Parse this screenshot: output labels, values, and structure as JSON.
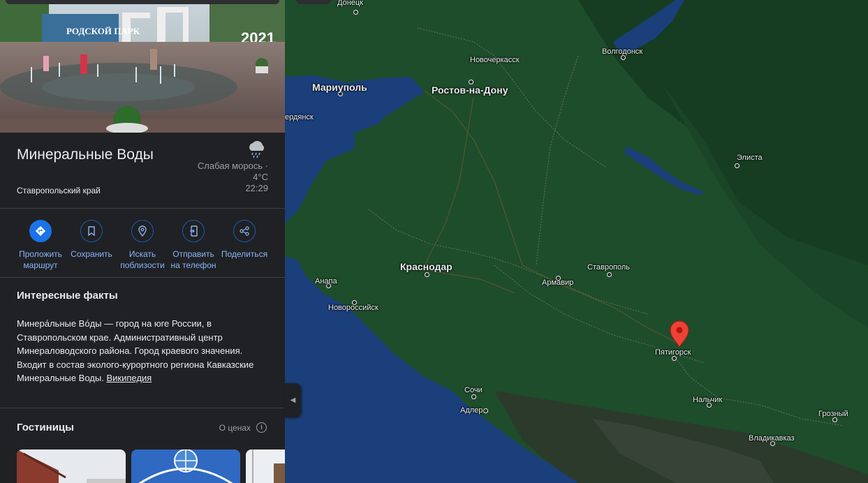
{
  "place": {
    "name": "Минеральные Воды",
    "region": "Ставропольский край",
    "weather": {
      "condition": "Слабая морось ·",
      "temperature": "4°C",
      "time": "22:29",
      "icon": "drizzle-icon"
    }
  },
  "actions": [
    {
      "label": "Проложить\nмаршрут",
      "icon": "directions-icon"
    },
    {
      "label": "Сохранить",
      "icon": "bookmark-icon"
    },
    {
      "label": "Искать\nпоблизости",
      "icon": "nearby-icon"
    },
    {
      "label": "Отправить\nна телефон",
      "icon": "send-to-phone-icon"
    },
    {
      "label": "Поделиться",
      "icon": "share-icon"
    }
  ],
  "facts": {
    "title": "Интересные факты",
    "text": "Минера́льные Во́ды — город на юге России, в Ставропольском крае. Административный центр Минераловодского района. Город краевого значения. Входит в состав эколого-курортного региона Кавказские Минеральные Воды.",
    "link": "Википедия"
  },
  "hotels": {
    "title": "Гостиницы",
    "prices_label": "О ценах"
  },
  "map": {
    "cities": [
      {
        "name": "Донецк",
        "big": false
      },
      {
        "name": "Новочеркасск",
        "big": false
      },
      {
        "name": "Волгодонск",
        "big": false
      },
      {
        "name": "Мариуполь",
        "big": true
      },
      {
        "name": "Ростов-на-Дону",
        "big": true
      },
      {
        "name": "ердянск",
        "big": false
      },
      {
        "name": "Элиста",
        "big": false
      },
      {
        "name": "Краснодар",
        "big": true
      },
      {
        "name": "Ставрополь",
        "big": false
      },
      {
        "name": "Анапа",
        "big": false
      },
      {
        "name": "Армавир",
        "big": false
      },
      {
        "name": "Новороссийск",
        "big": false
      },
      {
        "name": "Пятигорск",
        "big": false
      },
      {
        "name": "Сочи",
        "big": false
      },
      {
        "name": "Адлер",
        "big": false
      },
      {
        "name": "Нальчик",
        "big": false
      },
      {
        "name": "Грозный",
        "big": false
      },
      {
        "name": "Владикавказ",
        "big": false
      }
    ],
    "colors": {
      "sea": "#1a3f7a",
      "land": "#1e4d2b",
      "land_dark": "#163d21",
      "mountain": "#2c3a2c",
      "pin": "#ea4335"
    }
  }
}
